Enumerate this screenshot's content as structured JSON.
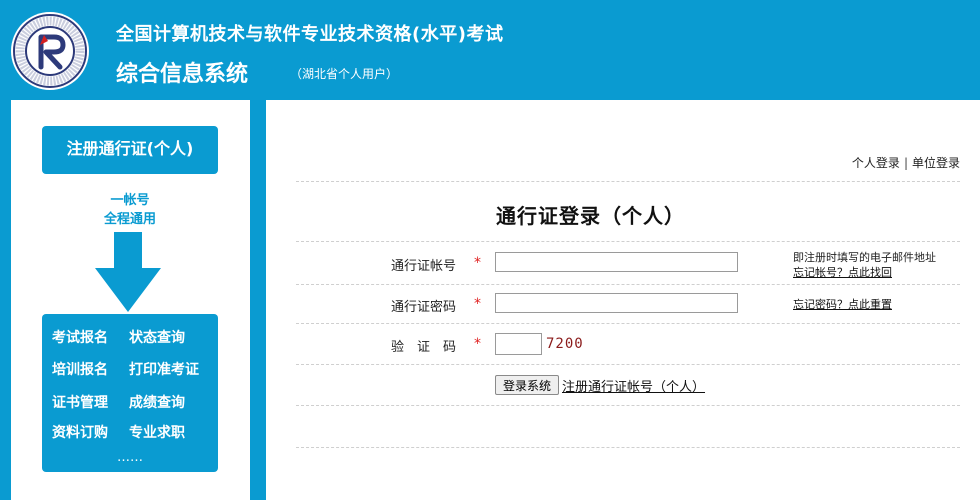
{
  "header": {
    "title_main": "全国计算机技术与软件专业技术资格(水平)考试",
    "title_sub": "综合信息系统",
    "title_note": "（湖北省个人用户）",
    "logo": {
      "top_text": "中国计算机资格考试",
      "bottom_text": "Computer Qualification Certification",
      "monogram": "R"
    }
  },
  "sidebar": {
    "register_button": "注册通行证(个人)",
    "slogan_line1": "一帐号",
    "slogan_line2": "全程通用",
    "menu": {
      "exam_signup": "考试报名",
      "status_query": "状态查询",
      "training_signup": "培训报名",
      "print_ticket": "打印准考证",
      "cert_manage": "证书管理",
      "score_query": "成绩查询",
      "material_order": "资料订购",
      "job_search": "专业求职",
      "more": "……"
    }
  },
  "top_links": {
    "personal_login": "个人登录",
    "separator": "|",
    "unit_login": "单位登录"
  },
  "login": {
    "title": "通行证登录（个人）",
    "account_label": "通行证帐号",
    "password_label": "通行证密码",
    "captcha_label": "验　证　码",
    "required_mark": "*",
    "account_value": "",
    "password_value": "",
    "captcha_input_value": "",
    "captcha_code": "7200",
    "account_hint": "即注册时填写的电子邮件地址",
    "forgot_account_link": "忘记帐号？点此找回",
    "forgot_password_link": "忘记密码？点此重置",
    "submit_button": "登录系统",
    "register_link": "注册通行证帐号（个人）"
  },
  "colors": {
    "brand_blue": "#0a9bd1",
    "required_red": "#e02020",
    "captcha_red": "#8b1b1b"
  }
}
